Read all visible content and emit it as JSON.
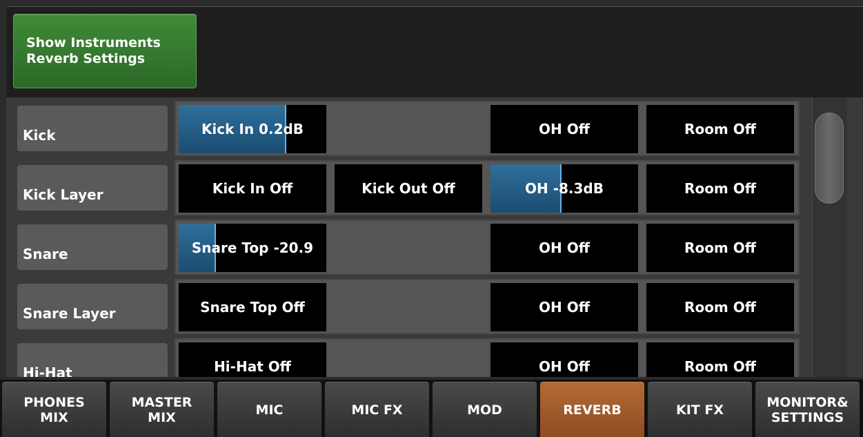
{
  "header": {
    "toggle_label": "Show Instruments\nReverb Settings"
  },
  "colors": {
    "toggle_green": "#2c6a27",
    "send_fill_blue": "#2f6f9a",
    "active_tab_orange": "#b56a36"
  },
  "rows": [
    {
      "label": "Kick",
      "cells": [
        {
          "text": "Kick In 0.2dB",
          "level": 0.73
        },
        {
          "text": "",
          "empty": true
        },
        {
          "text": "OH Off"
        },
        {
          "text": "Room Off"
        }
      ]
    },
    {
      "label": "Kick Layer",
      "cells": [
        {
          "text": "Kick In Off"
        },
        {
          "text": "Kick Out Off"
        },
        {
          "text": "OH -8.3dB",
          "level": 0.48
        },
        {
          "text": "Room Off"
        }
      ]
    },
    {
      "label": "Snare",
      "cells": [
        {
          "text": "Snare Top -20.9",
          "level": 0.25
        },
        {
          "text": "",
          "empty": true
        },
        {
          "text": "OH Off"
        },
        {
          "text": "Room Off"
        }
      ]
    },
    {
      "label": "Snare Layer",
      "cells": [
        {
          "text": "Snare Top Off"
        },
        {
          "text": "",
          "empty": true
        },
        {
          "text": "OH Off"
        },
        {
          "text": "Room Off"
        }
      ]
    },
    {
      "label": "Hi-Hat",
      "cells": [
        {
          "text": "Hi-Hat Off"
        },
        {
          "text": "",
          "empty": true
        },
        {
          "text": "OH Off"
        },
        {
          "text": "Room Off"
        }
      ]
    }
  ],
  "nav": [
    {
      "label": "PHONES\nMIX",
      "active": false
    },
    {
      "label": "MASTER\nMIX",
      "active": false
    },
    {
      "label": "MIC",
      "active": false
    },
    {
      "label": "MIC FX",
      "active": false
    },
    {
      "label": "MOD",
      "active": false
    },
    {
      "label": "REVERB",
      "active": true
    },
    {
      "label": "KIT FX",
      "active": false
    },
    {
      "label": "MONITOR&\nSETTINGS",
      "active": false
    }
  ]
}
